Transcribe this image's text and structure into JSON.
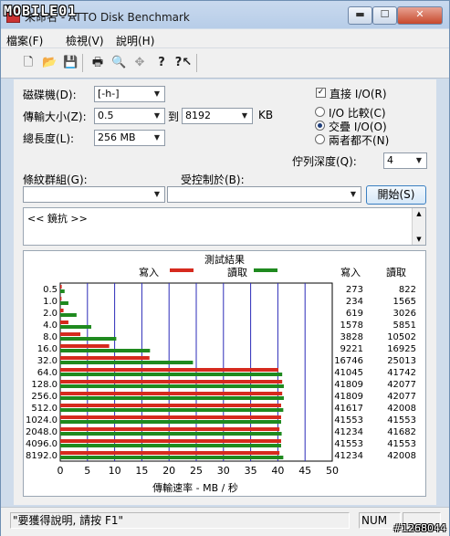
{
  "window": {
    "title": "未命名 - ATTO Disk Benchmark",
    "logo_text": "MOBILE01",
    "buttons": {
      "minimize": "▬",
      "maximize": "☐",
      "close": "✕"
    }
  },
  "menu": [
    "檔案(F)",
    "檢視(V)",
    "說明(H)"
  ],
  "toolbar": {
    "icons": [
      "new-file-icon",
      "open-folder-icon",
      "save-icon",
      "print-icon",
      "print-preview-icon",
      "move-icon",
      "help-icon",
      "context-help-icon"
    ],
    "glyphs": [
      "🗋",
      "📂",
      "💾",
      "🖶",
      "🔍",
      "✥",
      "?",
      "?↖"
    ]
  },
  "form": {
    "drive_label": "磁碟機(D):",
    "drive_value": "[-h-]",
    "transfer_label": "傳輸大小(Z):",
    "transfer_from": "0.5",
    "to_label": "到",
    "transfer_to": "8192",
    "kb_unit": "KB",
    "length_label": "總長度(L):",
    "length_value": "256 MB",
    "direct_io_label": "直接 I/O(R)",
    "direct_io_checked": true,
    "radio_io_compare": "I/O 比較(C)",
    "radio_overlap": "交疊 I/O(O)",
    "radio_neither": "兩者都不(N)",
    "radio_selected": "overlap",
    "queue_label": "佇列深度(Q):",
    "queue_value": "4",
    "pattern_label": "條紋群組(G):",
    "pattern_value": "",
    "controlled_label": "受控制於(B):",
    "controlled_value": "",
    "start_button": "開始(S)",
    "notes_text": "<< 鏡抗 >>"
  },
  "results": {
    "title": "測試結果",
    "legend_write": "寫入",
    "legend_read": "讀取",
    "write_color": "#d62a1e",
    "read_color": "#1f8a1f",
    "col_write": "寫入",
    "col_read": "讀取"
  },
  "chart_data": {
    "type": "bar",
    "orientation": "horizontal",
    "title": "測試結果",
    "xlabel": "傳輸速率 - MB / 秒",
    "xlim": [
      0,
      50
    ],
    "xticks": [
      0,
      5,
      10,
      15,
      20,
      25,
      30,
      35,
      40,
      45,
      50
    ],
    "categories": [
      "0.5",
      "1.0",
      "2.0",
      "4.0",
      "8.0",
      "16.0",
      "32.0",
      "64.0",
      "128.0",
      "256.0",
      "512.0",
      "1024.0",
      "2048.0",
      "4096.0",
      "8192.0"
    ],
    "series": [
      {
        "name": "寫入",
        "values": [
          0.27,
          0.23,
          0.6,
          1.5,
          3.7,
          9.0,
          16.4,
          40.1,
          40.8,
          40.8,
          40.6,
          40.6,
          40.3,
          40.6,
          40.3
        ]
      },
      {
        "name": "讀取",
        "values": [
          0.8,
          1.5,
          3.0,
          5.7,
          10.3,
          16.5,
          24.4,
          40.8,
          41.1,
          41.1,
          41.0,
          40.6,
          40.7,
          40.6,
          41.0
        ]
      }
    ],
    "table": {
      "write": [
        "273",
        "234",
        "619",
        "1578",
        "3828",
        "9221",
        "16746",
        "41045",
        "41809",
        "41809",
        "41617",
        "41553",
        "41234",
        "41553",
        "41234"
      ],
      "read": [
        "822",
        "1565",
        "3026",
        "5851",
        "10502",
        "16925",
        "25013",
        "41742",
        "42077",
        "42077",
        "42008",
        "41553",
        "41682",
        "41553",
        "42008"
      ]
    },
    "grid": true,
    "legend": "top"
  },
  "status": {
    "hint": "\"要獲得說明, 請按 F1\"",
    "num": "NUM"
  },
  "watermark": "#1268044"
}
